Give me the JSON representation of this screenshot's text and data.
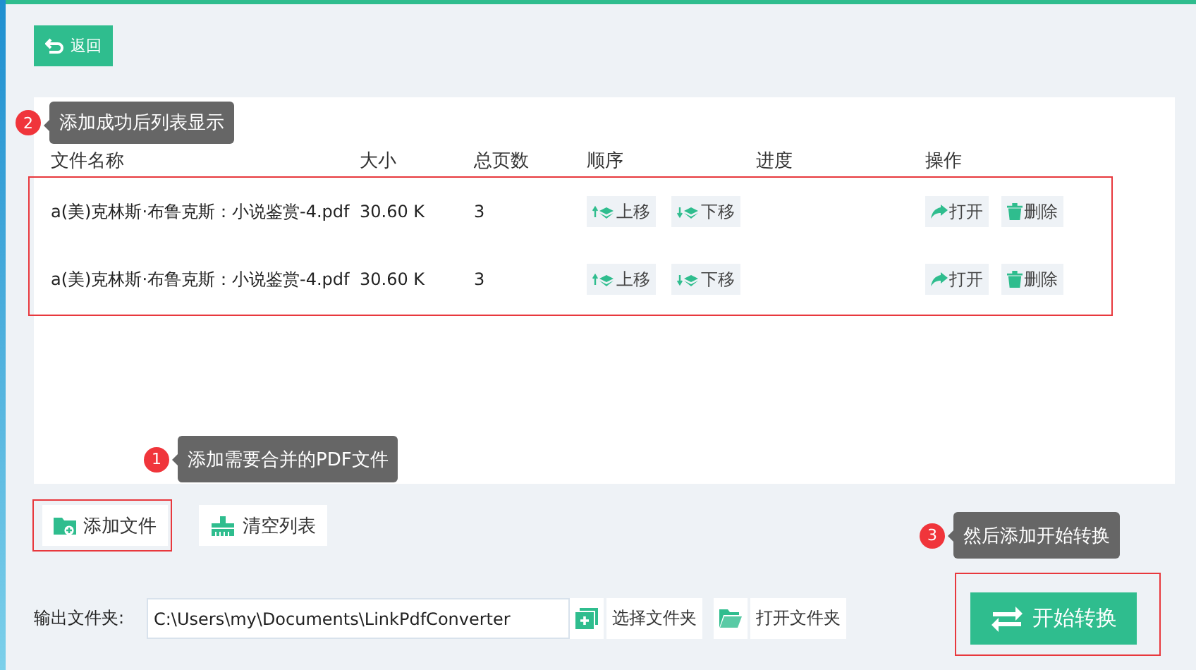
{
  "back_button": {
    "label": "返回"
  },
  "table": {
    "columns": [
      "文件名称",
      "大小",
      "总页数",
      "顺序",
      "进度",
      "操作"
    ],
    "rows": [
      {
        "name": "a(美)克林斯·布鲁克斯：小说鉴赏-4.pdf",
        "size": "30.60 K",
        "pages": "3",
        "move_up": "上移",
        "move_down": "下移",
        "open": "打开",
        "delete": "删除"
      },
      {
        "name": "a(美)克林斯·布鲁克斯：小说鉴赏-4.pdf",
        "size": "30.60 K",
        "pages": "3",
        "move_up": "上移",
        "move_down": "下移",
        "open": "打开",
        "delete": "删除"
      }
    ]
  },
  "toolbar": {
    "add_file": "添加文件",
    "clear_list": "清空列表"
  },
  "output": {
    "label": "输出文件夹:",
    "value": "C:\\Users\\my\\Documents\\LinkPdfConverter",
    "choose_folder": "选择文件夹",
    "open_folder": "打开文件夹"
  },
  "start_button": {
    "label": "开始转换"
  },
  "annotations": [
    {
      "number": "1",
      "text": "添加需要合并的PDF文件"
    },
    {
      "number": "2",
      "text": "添加成功后列表显示"
    },
    {
      "number": "3",
      "text": "然后添加开始转换"
    }
  ]
}
